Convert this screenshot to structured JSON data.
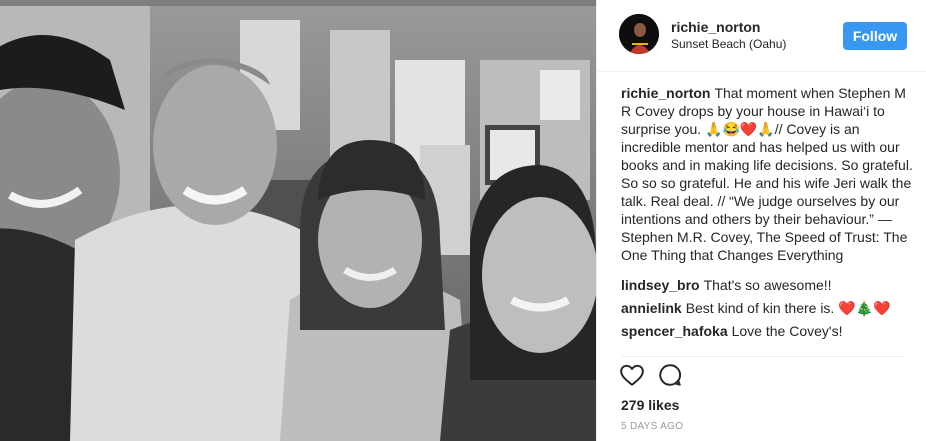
{
  "post": {
    "username": "richie_norton",
    "location": "Sunset Beach (Oahu)",
    "follow_label": "Follow"
  },
  "comments": [
    {
      "user": "richie_norton",
      "text": "That moment when Stephen M R Covey drops by your house in Hawai‘i to surprise you. 🙏😂❤️🙏// Covey is an incredible mentor and has helped us with our books and in making life decisions. So grateful. So so so grateful. He and his wife Jeri walk the talk. Real deal. // “We judge ourselves by our intentions and others by their behaviour.” — Stephen M.R. Covey, The Speed of Trust: The One Thing that Changes Everything"
    },
    {
      "user": "lindsey_bro",
      "text": "That's so awesome!!"
    },
    {
      "user": "annielink",
      "text": "Best kind of kin there is. ❤️🎄❤️"
    },
    {
      "user": "spencer_hafoka",
      "text": "Love the Covey's!"
    }
  ],
  "actions": {
    "like_icon": "heart-outline",
    "comment_icon": "speech-bubble-outline"
  },
  "likes": "279 likes",
  "timestamp": "5 DAYS AGO"
}
